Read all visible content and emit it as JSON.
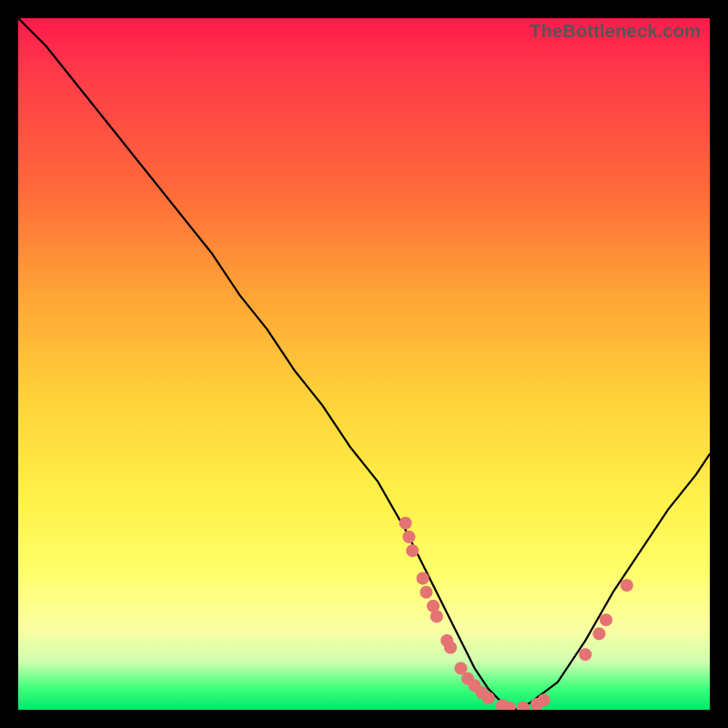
{
  "watermark": "TheBottleneck.com",
  "colors": {
    "gradient_top": "#ff1a4d",
    "gradient_bottom": "#00e86a",
    "curve": "#000000",
    "points": "#e57373",
    "page_bg": "#000000"
  },
  "chart_data": {
    "type": "line",
    "title": "",
    "xlabel": "",
    "ylabel": "",
    "xlim": [
      0,
      100
    ],
    "ylim": [
      0,
      100
    ],
    "grid": false,
    "series": [
      {
        "name": "bottleneck-curve",
        "x": [
          0,
          4,
          8,
          12,
          16,
          20,
          24,
          28,
          32,
          36,
          40,
          44,
          48,
          52,
          56,
          58,
          60,
          62,
          64,
          66,
          68,
          70,
          72,
          74,
          78,
          82,
          86,
          90,
          94,
          98,
          100
        ],
        "y": [
          100,
          96,
          91,
          86,
          81,
          76,
          71,
          66,
          60,
          55,
          49,
          44,
          38,
          33,
          26,
          22,
          18,
          14,
          10,
          6,
          3,
          1,
          0,
          1,
          4,
          10,
          17,
          23,
          29,
          34,
          37
        ]
      }
    ],
    "points": [
      {
        "x": 56,
        "y": 27
      },
      {
        "x": 56.5,
        "y": 25
      },
      {
        "x": 57,
        "y": 23
      },
      {
        "x": 58.5,
        "y": 19
      },
      {
        "x": 59,
        "y": 17
      },
      {
        "x": 60,
        "y": 15
      },
      {
        "x": 60.5,
        "y": 13.5
      },
      {
        "x": 62,
        "y": 10
      },
      {
        "x": 62.5,
        "y": 9
      },
      {
        "x": 64,
        "y": 6
      },
      {
        "x": 65,
        "y": 4.5
      },
      {
        "x": 66,
        "y": 3.5
      },
      {
        "x": 67,
        "y": 2.5
      },
      {
        "x": 68,
        "y": 1.7
      },
      {
        "x": 70,
        "y": 0.6
      },
      {
        "x": 71,
        "y": 0.3
      },
      {
        "x": 73,
        "y": 0.3
      },
      {
        "x": 75,
        "y": 0.8
      },
      {
        "x": 76,
        "y": 1.4
      },
      {
        "x": 82,
        "y": 8
      },
      {
        "x": 84,
        "y": 11
      },
      {
        "x": 85,
        "y": 13
      },
      {
        "x": 88,
        "y": 18
      }
    ]
  }
}
